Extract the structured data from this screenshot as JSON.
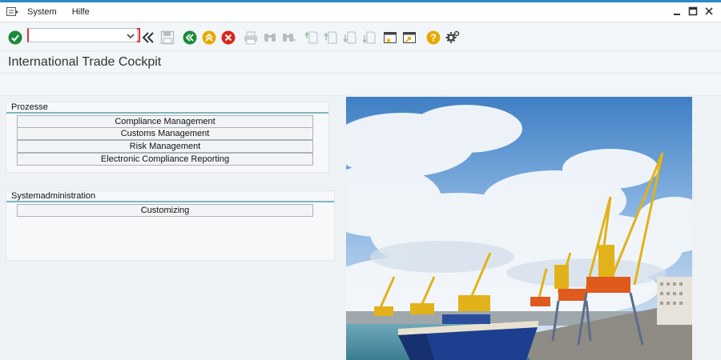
{
  "menubar": {
    "items": [
      {
        "label": "System"
      },
      {
        "label": "Hilfe"
      }
    ]
  },
  "toolbar": {
    "command_value": "",
    "icons": [
      "enter-icon",
      "back-double-icon",
      "save-icon",
      "back-icon",
      "exit-icon",
      "cancel-icon",
      "print-icon",
      "find-icon",
      "find-next-icon",
      "first-page-icon",
      "prev-page-icon",
      "next-page-icon",
      "last-page-icon",
      "create-session-icon",
      "shortcut-icon",
      "help-icon",
      "customize-layout-icon"
    ]
  },
  "page": {
    "title": "International Trade Cockpit"
  },
  "groups": [
    {
      "title": "Prozesse",
      "buttons": [
        "Compliance Management",
        "Customs Management",
        "Risk Management",
        "Electronic Compliance Reporting"
      ]
    },
    {
      "title": "Systemadministration",
      "buttons": [
        "Customizing"
      ]
    }
  ],
  "image": {
    "subject": "harbor-cranes-photo"
  },
  "colors": {
    "accent_line": "#2e88c7",
    "enter_green": "#1a8a3a",
    "back_yellow": "#e9a800",
    "cancel_red": "#d9261c",
    "group_line": "#7fb6bf"
  }
}
